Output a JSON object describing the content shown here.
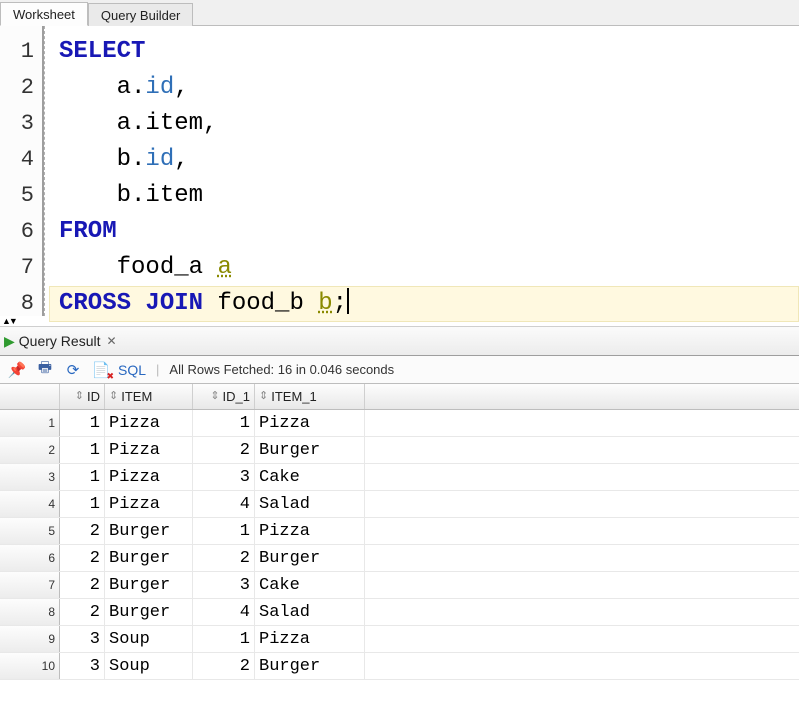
{
  "tabs": {
    "worksheet": "Worksheet",
    "query_builder": "Query Builder"
  },
  "editor": {
    "lines": [
      [
        {
          "cls": "kw",
          "t": "SELECT"
        }
      ],
      [
        {
          "cls": "txt",
          "t": "    a."
        },
        {
          "cls": "col",
          "t": "id"
        },
        {
          "cls": "txt",
          "t": ","
        }
      ],
      [
        {
          "cls": "txt",
          "t": "    a.item,"
        }
      ],
      [
        {
          "cls": "txt",
          "t": "    b."
        },
        {
          "cls": "col",
          "t": "id"
        },
        {
          "cls": "txt",
          "t": ","
        }
      ],
      [
        {
          "cls": "txt",
          "t": "    b.item"
        }
      ],
      [
        {
          "cls": "kw",
          "t": "FROM"
        }
      ],
      [
        {
          "cls": "txt",
          "t": "    food_a "
        },
        {
          "cls": "alias",
          "t": "a"
        }
      ],
      [
        {
          "cls": "kw",
          "t": "CROSS JOIN"
        },
        {
          "cls": "txt",
          "t": " food_b "
        },
        {
          "cls": "alias",
          "t": "b"
        },
        {
          "cls": "txt",
          "t": ";"
        }
      ]
    ],
    "highlight_line": 8
  },
  "result_tab": {
    "label": "Query Result"
  },
  "toolbar": {
    "sql_label": "SQL",
    "status": "All Rows Fetched: 16 in 0.046 seconds"
  },
  "grid": {
    "columns": [
      "ID",
      "ITEM",
      "ID_1",
      "ITEM_1"
    ],
    "rows": [
      {
        "n": "1",
        "id": "1",
        "item": "Pizza",
        "id1": "1",
        "item1": "Pizza"
      },
      {
        "n": "2",
        "id": "1",
        "item": "Pizza",
        "id1": "2",
        "item1": "Burger"
      },
      {
        "n": "3",
        "id": "1",
        "item": "Pizza",
        "id1": "3",
        "item1": "Cake"
      },
      {
        "n": "4",
        "id": "1",
        "item": "Pizza",
        "id1": "4",
        "item1": "Salad"
      },
      {
        "n": "5",
        "id": "2",
        "item": "Burger",
        "id1": "1",
        "item1": "Pizza"
      },
      {
        "n": "6",
        "id": "2",
        "item": "Burger",
        "id1": "2",
        "item1": "Burger"
      },
      {
        "n": "7",
        "id": "2",
        "item": "Burger",
        "id1": "3",
        "item1": "Cake"
      },
      {
        "n": "8",
        "id": "2",
        "item": "Burger",
        "id1": "4",
        "item1": "Salad"
      },
      {
        "n": "9",
        "id": "3",
        "item": "Soup",
        "id1": "1",
        "item1": "Pizza"
      },
      {
        "n": "10",
        "id": "3",
        "item": "Soup",
        "id1": "2",
        "item1": "Burger"
      }
    ]
  }
}
